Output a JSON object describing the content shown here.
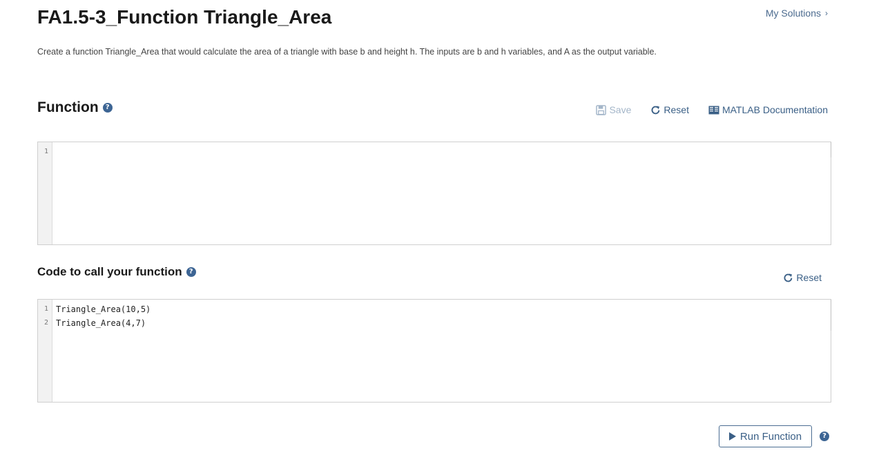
{
  "header": {
    "title": "FA1.5-3_Function Triangle_Area",
    "my_solutions_label": "My Solutions",
    "my_solutions_chevron": "›",
    "description": "Create a function Triangle_Area that would calculate the area of a triangle with base b and height h. The inputs are b and h variables, and A as the output variable."
  },
  "function_section": {
    "title": "Function",
    "help_glyph": "?",
    "toolbar": {
      "save_label": "Save",
      "reset_label": "Reset",
      "docs_label": "MATLAB Documentation"
    },
    "editor": {
      "line_numbers": [
        "1"
      ],
      "lines": [
        ""
      ]
    }
  },
  "call_section": {
    "title": "Code to call your function",
    "help_glyph": "?",
    "reset_label": "Reset",
    "editor": {
      "line_numbers": [
        "1",
        "2"
      ],
      "lines": [
        "Triangle_Area(10,5)",
        "Triangle_Area(4,7)"
      ]
    }
  },
  "run": {
    "label": "Run Function",
    "help_glyph": "?"
  },
  "colors": {
    "accent": "#3a5f86",
    "disabled": "#a4b6c9",
    "help_icon": "#3d6594",
    "editor_border": "#cfcfcf",
    "gutter_bg": "#f2f2f2"
  },
  "icons": {
    "save": "floppy-disk-icon",
    "reset": "refresh-icon",
    "docs": "book-icon",
    "run": "play-icon",
    "help": "question-circle-icon",
    "chevron": "chevron-right-icon"
  }
}
